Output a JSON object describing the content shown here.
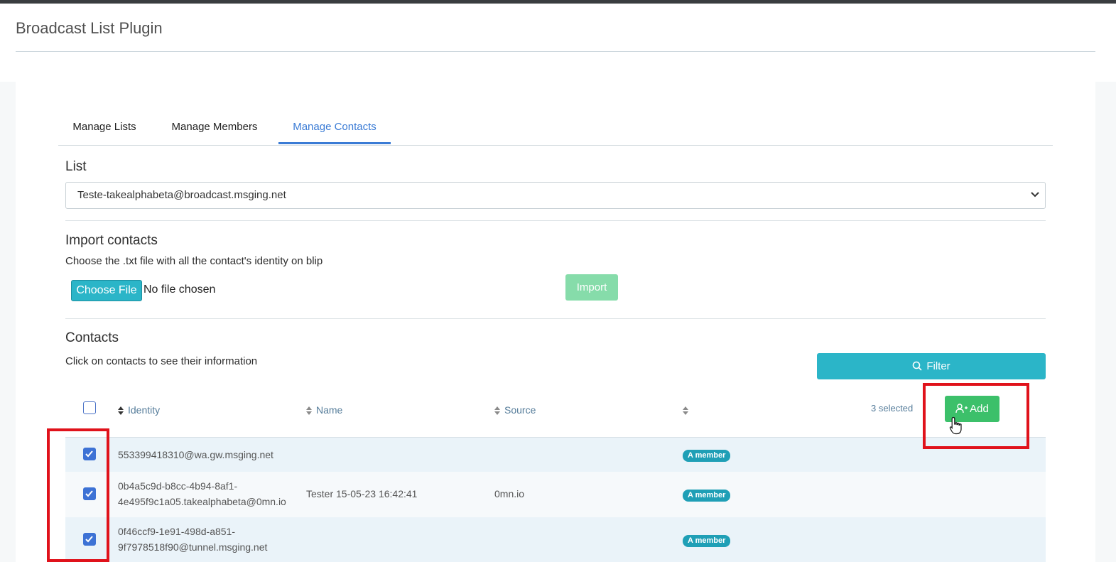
{
  "page": {
    "title": "Broadcast List Plugin"
  },
  "tabs": [
    {
      "label": "Manage Lists",
      "active": false
    },
    {
      "label": "Manage Members",
      "active": false
    },
    {
      "label": "Manage Contacts",
      "active": true
    }
  ],
  "list": {
    "section_title": "List",
    "selected": "Teste-takealphabeta@broadcast.msging.net"
  },
  "import": {
    "section_title": "Import contacts",
    "description": "Choose the .txt file with all the contact's identity on blip",
    "choose_file_label": "Choose File",
    "no_file_text": "No file chosen",
    "import_label": "Import"
  },
  "contacts": {
    "section_title": "Contacts",
    "description": "Click on contacts to see their information",
    "filter_label": "Filter",
    "selected_count": "3 selected",
    "add_label": "Add",
    "columns": [
      "Identity",
      "Name",
      "Source",
      ""
    ],
    "rows": [
      {
        "identity_line1": "553399418310@wa.gw.msging.net",
        "identity_line2": "",
        "name": "",
        "source": "",
        "badge": "A member",
        "checked": true
      },
      {
        "identity_line1": "0b4a5c9d-b8cc-4b94-8af1-",
        "identity_line2": "4e495f9c1a05.takealphabeta@0mn.io",
        "name": "Tester 15-05-23 16:42:41",
        "source": "0mn.io",
        "badge": "A member",
        "checked": true
      },
      {
        "identity_line1": "0f46ccf9-1e91-498d-a851-",
        "identity_line2": "9f7978518f90@tunnel.msging.net",
        "name": "",
        "source": "",
        "badge": "A member",
        "checked": true
      }
    ]
  },
  "colors": {
    "accent_blue": "#3a7bd5",
    "teal": "#2bb5c8",
    "green": "#3cc06a",
    "highlight_red": "#e0121b"
  }
}
